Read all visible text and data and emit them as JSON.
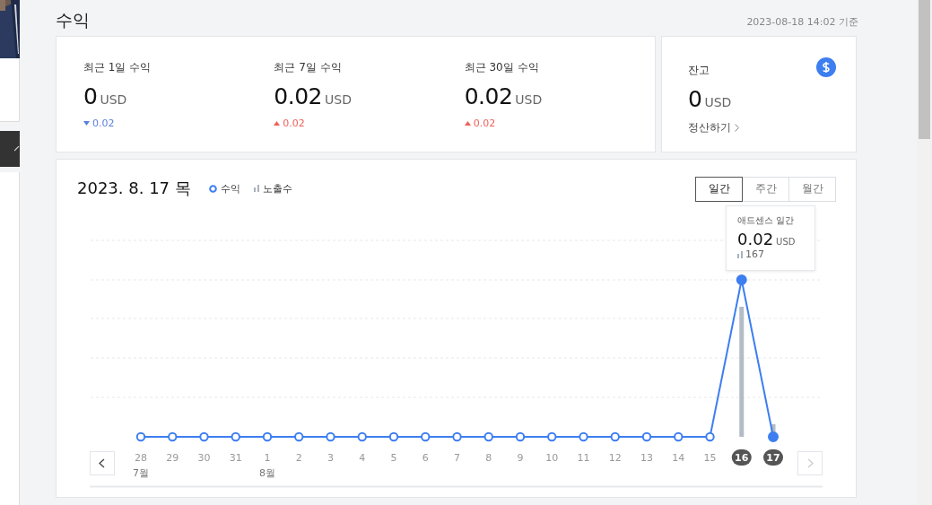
{
  "page_title": "수익",
  "updated_at": "2023-08-18 14:02 기준",
  "stats": [
    {
      "label": "최근 1일 수익",
      "value": "0",
      "unit": "USD",
      "change": "0.02",
      "rising": false
    },
    {
      "label": "최근 7일 수익",
      "value": "0.02",
      "unit": "USD",
      "change": "0.02",
      "rising": true
    },
    {
      "label": "최근 30일 수익",
      "value": "0.02",
      "unit": "USD",
      "change": "0.02",
      "rising": true
    }
  ],
  "balance": {
    "label": "잔고",
    "value": "0",
    "unit": "USD",
    "link": "정산하기"
  },
  "chart": {
    "date": "2023. 8. 17 목",
    "legend": [
      {
        "label": "수익",
        "kind": "line"
      },
      {
        "label": "노출수",
        "kind": "bar"
      }
    ],
    "tabs": [
      {
        "label": "일간",
        "selected": true
      },
      {
        "label": "주간",
        "selected": false
      },
      {
        "label": "월간",
        "selected": false
      }
    ],
    "tooltip": {
      "title": "애드센스 일간",
      "value": "0.02",
      "unit": "USD",
      "impressions": "167"
    },
    "days": [
      {
        "day": "28",
        "month": "7월",
        "selected": false
      },
      {
        "day": "29",
        "selected": false
      },
      {
        "day": "30",
        "selected": false
      },
      {
        "day": "31",
        "selected": false
      },
      {
        "day": "1",
        "month": "8월",
        "selected": false
      },
      {
        "day": "2",
        "selected": false
      },
      {
        "day": "3",
        "selected": false
      },
      {
        "day": "4",
        "selected": false
      },
      {
        "day": "5",
        "selected": false
      },
      {
        "day": "6",
        "selected": false
      },
      {
        "day": "7",
        "selected": false
      },
      {
        "day": "8",
        "selected": false
      },
      {
        "day": "9",
        "selected": false
      },
      {
        "day": "10",
        "selected": false
      },
      {
        "day": "11",
        "selected": false
      },
      {
        "day": "12",
        "selected": false
      },
      {
        "day": "13",
        "selected": false
      },
      {
        "day": "14",
        "selected": false
      },
      {
        "day": "15",
        "selected": false
      },
      {
        "day": "16",
        "selected": true
      },
      {
        "day": "17",
        "selected": true
      }
    ]
  }
}
